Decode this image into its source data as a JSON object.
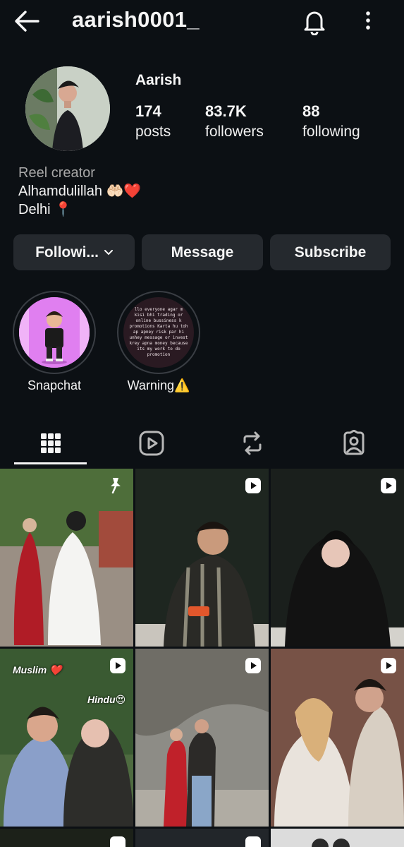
{
  "header": {
    "username": "aarish0001_",
    "back_icon": "arrow-left-icon",
    "bell_icon": "bell-icon",
    "more_icon": "more-vertical-icon"
  },
  "profile": {
    "display_name": "Aarish",
    "stats": [
      {
        "value": "174",
        "label": "posts"
      },
      {
        "value": "83.7K",
        "label": "followers"
      },
      {
        "value": "88",
        "label": "following"
      }
    ],
    "bio": {
      "category": "Reel creator",
      "line1": "Alhamdulillah 🤲🏻❤️",
      "line2": "Delhi 📍"
    }
  },
  "actions": {
    "following_label": "Followi...",
    "message_label": "Message",
    "subscribe_label": "Subscribe"
  },
  "highlights": [
    {
      "label": "Snapchat"
    },
    {
      "label": "Warning⚠️"
    }
  ],
  "warning_highlight_text": "llo everyone agar m kisi bhi trading or online bussiness k promotions Karta hu toh ap apney risk par hi unhey message or invest krey apna money because its my work to do promotion",
  "tabs": [
    {
      "name": "posts-grid",
      "icon": "grid-icon",
      "active": true
    },
    {
      "name": "reels",
      "icon": "reels-icon",
      "active": false
    },
    {
      "name": "reposts",
      "icon": "repost-icon",
      "active": false
    },
    {
      "name": "tagged",
      "icon": "tagged-user-icon",
      "active": false
    }
  ],
  "grid_captions": {
    "muslim": "Muslim ❤️",
    "hindu": "Hindu😍"
  },
  "colors": {
    "background": "#0c1014",
    "button_bg": "#25292e",
    "secondary_text": "#a8a8a8",
    "snapchat_purple": "#e07ff0"
  }
}
